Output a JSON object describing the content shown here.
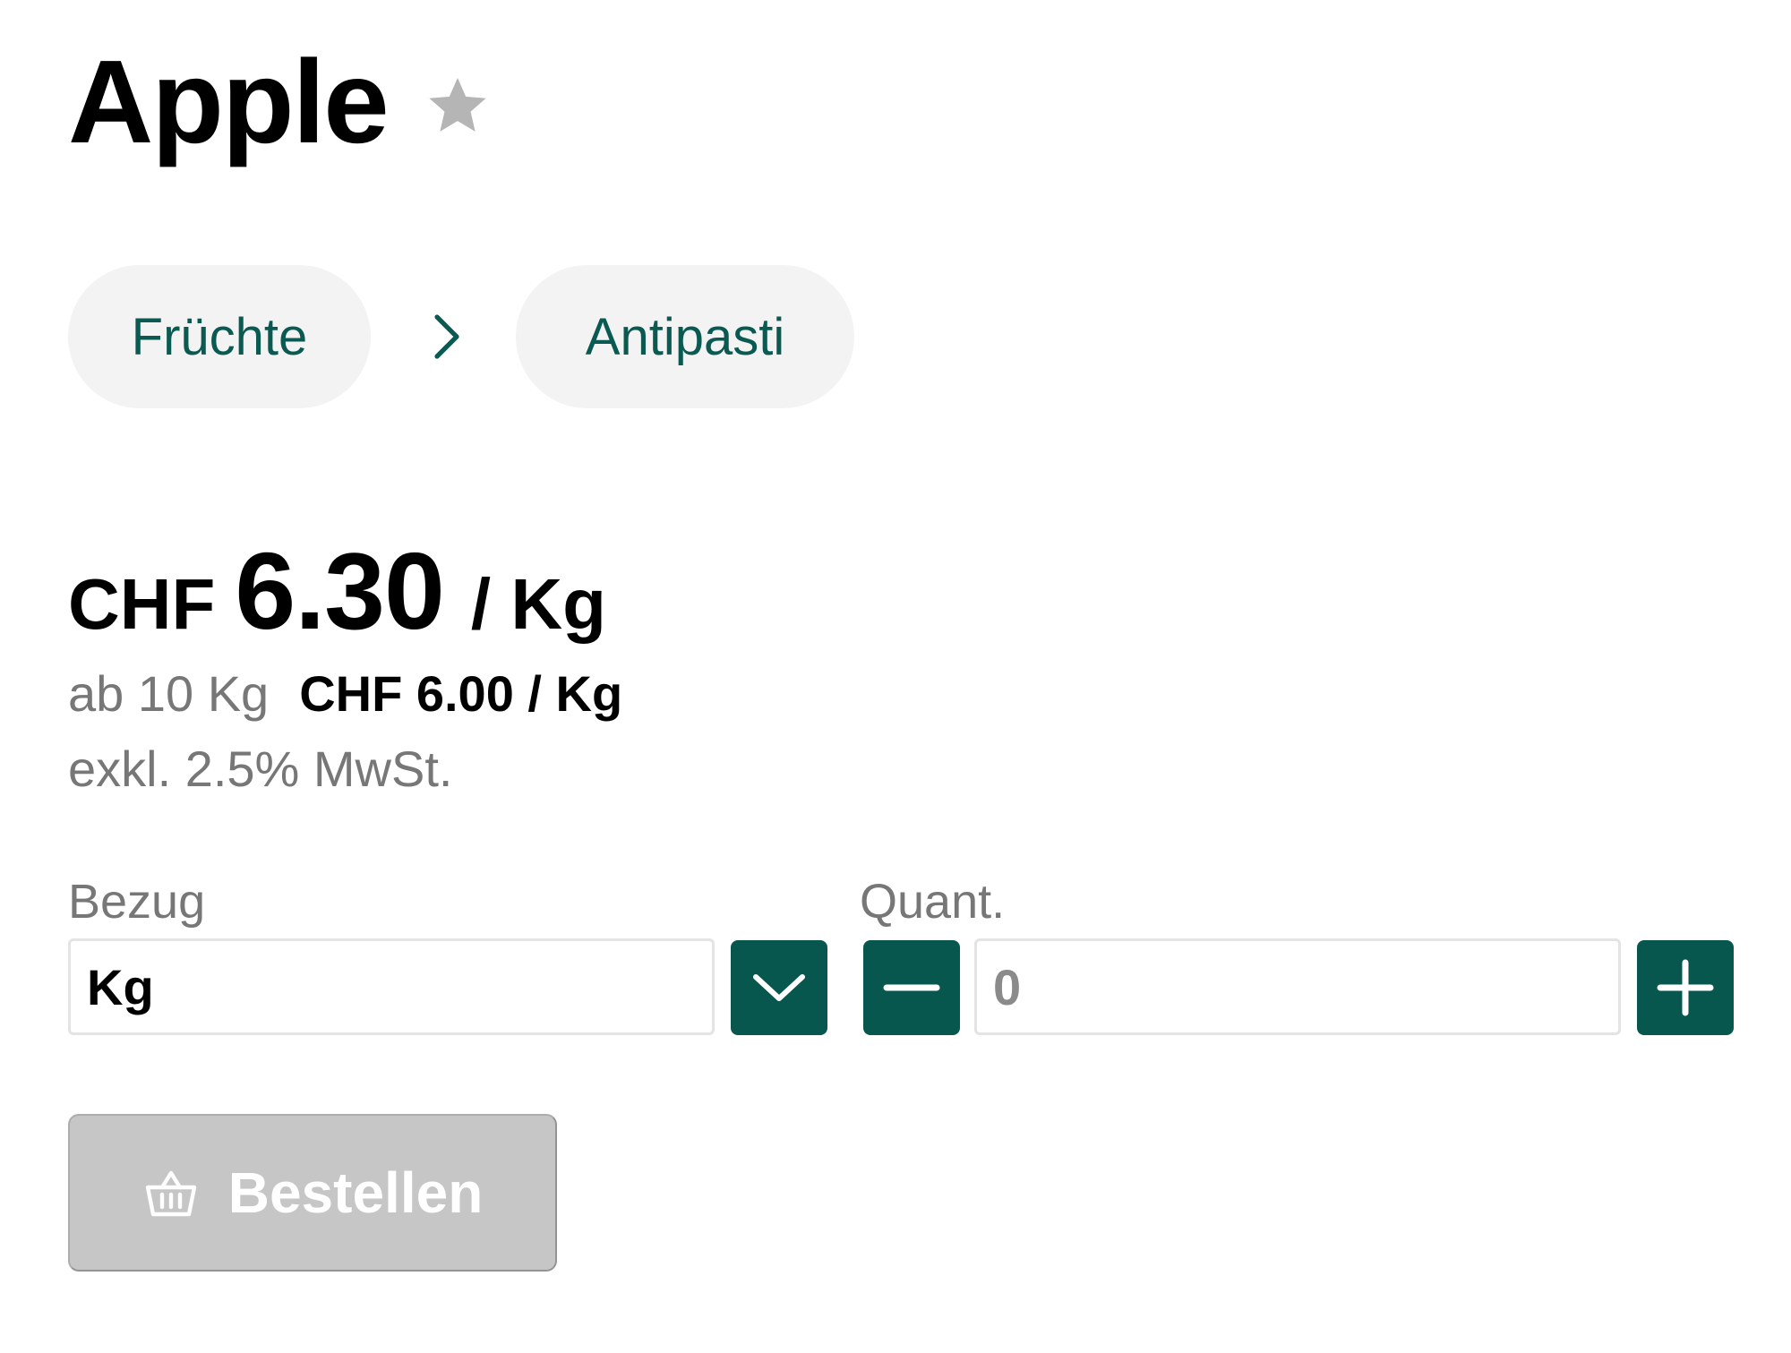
{
  "product": {
    "title": "Apple",
    "favorite_icon": "star-icon"
  },
  "breadcrumb": {
    "items": [
      {
        "label": "Früchte"
      },
      {
        "label": "Antipasti"
      }
    ],
    "separator_icon": "chevron-right-icon"
  },
  "price": {
    "currency": "CHF",
    "amount": "6.30",
    "unit": "/ Kg",
    "tier_label": "ab 10 Kg",
    "tier_price": "CHF 6.00 / Kg",
    "vat_note": "exkl. 2.5% MwSt."
  },
  "order_form": {
    "unit_label": "Bezug",
    "unit_value": "Kg",
    "quantity_label": "Quant.",
    "quantity_value": "0",
    "order_button_label": "Bestellen",
    "order_button_icon": "basket-icon",
    "order_button_disabled": true
  },
  "colors": {
    "brand_green": "#07574f",
    "link_green": "#0b5a52",
    "chip_background": "#f3f3f3",
    "disabled_button": "#c6c6c6",
    "star_grey": "#b5b5b5"
  }
}
